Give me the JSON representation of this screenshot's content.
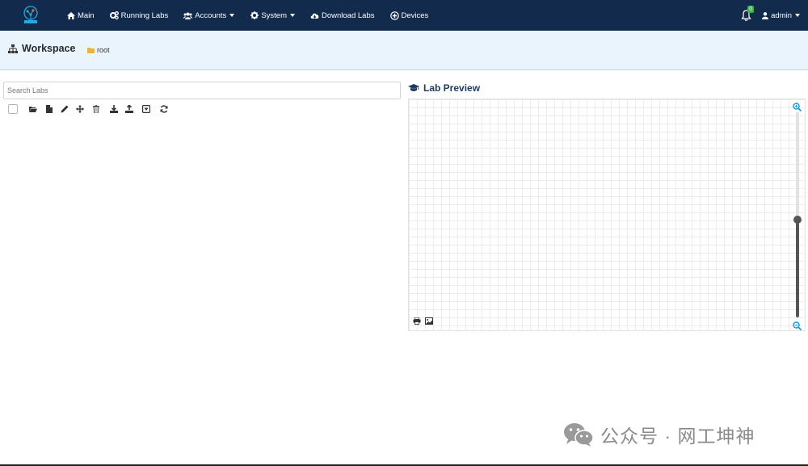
{
  "nav": {
    "items": [
      {
        "label": "Main",
        "icon": "home-icon"
      },
      {
        "label": "Running Labs",
        "icon": "cogs-icon"
      },
      {
        "label": "Accounts",
        "icon": "users-icon"
      },
      {
        "label": "System",
        "icon": "gear-icon"
      },
      {
        "label": "Download Labs",
        "icon": "cloud-download-icon"
      },
      {
        "label": "Devices",
        "icon": "plus-circle-icon"
      }
    ],
    "notifications": "0",
    "user": "admin"
  },
  "workspace": {
    "title": "Workspace",
    "breadcrumb": "root"
  },
  "search": {
    "placeholder": "Search Labs",
    "value": ""
  },
  "toolbar": {
    "icons": [
      "open-folder-icon",
      "new-file-icon",
      "rename-icon",
      "move-icon",
      "delete-icon",
      "export-icon",
      "import-icon",
      "select-all-icon",
      "refresh-icon"
    ]
  },
  "preview": {
    "title": "Lab Preview",
    "zoom_level": 0.47
  },
  "watermark": "公众号 · 网工坤神",
  "colors": {
    "navbar": "#122a4c",
    "header_bg": "#eaf4fc",
    "accent": "#1a9bd7",
    "badge": "#3bb34a"
  }
}
